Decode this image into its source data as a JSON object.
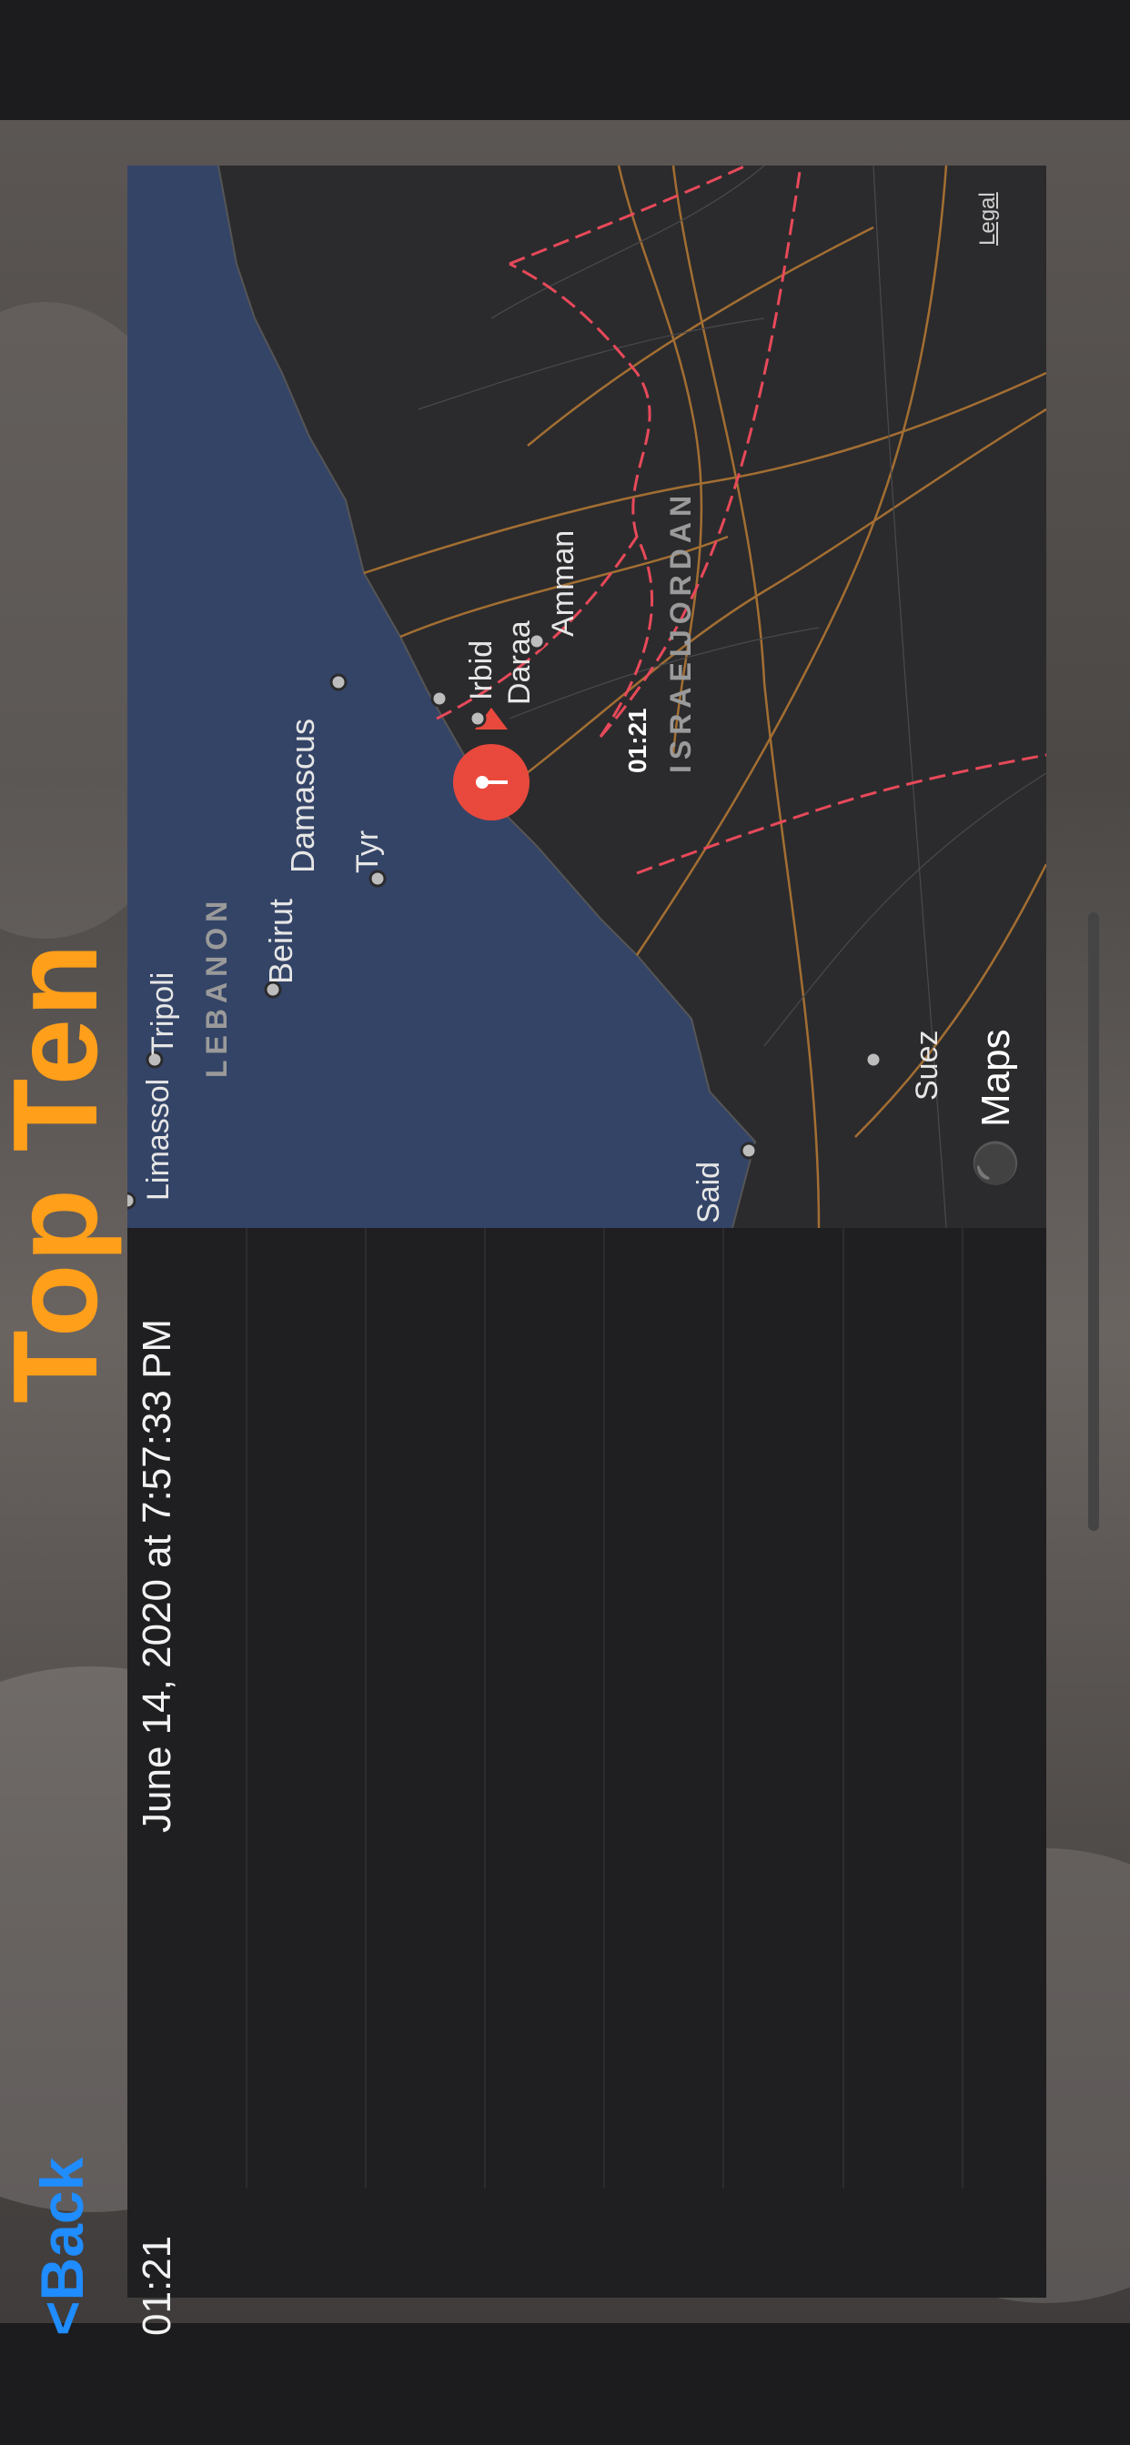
{
  "nav": {
    "back_label": "<Back",
    "title": "Top Ten"
  },
  "header": {
    "time": "01:21",
    "date": "June 14, 2020 at 7:57:33 PM"
  },
  "map": {
    "labels": {
      "limassol": "Limassol",
      "tripoli": "Tripoli",
      "lebanon": "LEBANON",
      "beirut": "Beirut",
      "damascus": "Damascus",
      "tyr": "Tyr",
      "irbid": "Irbid",
      "daraa": "Daraa",
      "amman": "Amman",
      "jordan": "JORDAN",
      "israel": "ISRAEL",
      "said": "Said",
      "suez": "Suez"
    },
    "pin_label": "01:21",
    "legal": "Legal",
    "brand": "Maps"
  },
  "colors": {
    "accent_orange": "#ff9f1a",
    "link_blue": "#1f8cff",
    "sea": "#344467",
    "land": "#2b2b2d",
    "border": "#e8495a",
    "road": "#b97a34",
    "pin": "#e9493c"
  }
}
